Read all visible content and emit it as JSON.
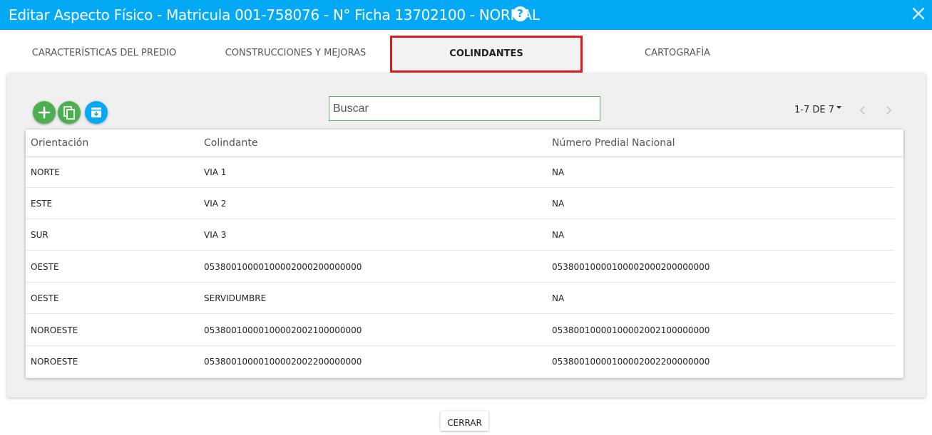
{
  "window": {
    "title": "Editar Aspecto Físico - Matricula 001-758076 - N° Ficha 13702100 - NORMAL"
  },
  "tabs": [
    {
      "label": "CARACTERÍSTICAS DEL PREDIO"
    },
    {
      "label": "CONSTRUCCIONES Y MEJORAS"
    },
    {
      "label": "COLINDANTES"
    },
    {
      "label": "CARTOGRAFÍA"
    }
  ],
  "search": {
    "placeholder": "Buscar"
  },
  "pager": {
    "label": "1-7 DE 7"
  },
  "table": {
    "headers": [
      "Orientación",
      "Colindante",
      "Número Predial Nacional"
    ],
    "rows": [
      [
        "NORTE",
        "VIA 1",
        "NA"
      ],
      [
        "ESTE",
        "VIA 2",
        "NA"
      ],
      [
        "SUR",
        "VIA 3",
        "NA"
      ],
      [
        "OESTE",
        "05380010000100002000200000000",
        "05380010000100002000200000000"
      ],
      [
        "OESTE",
        "SERVIDUMBRE",
        "NA"
      ],
      [
        "NOROESTE",
        "05380010000100002002100000000",
        "05380010000100002002100000000"
      ],
      [
        "NOROESTE",
        "05380010000100002002200000000",
        "05380010000100002002200000000"
      ]
    ]
  },
  "footer": {
    "close_label": "CERRAR"
  },
  "colors": {
    "header": "#03a9f4",
    "add": "#4caf50",
    "highlight": "#e01b1b"
  },
  "icons": [
    "help-icon",
    "close-icon",
    "add-icon",
    "copy-icon",
    "archive-icon",
    "chevron-left-icon",
    "chevron-right-icon",
    "caret-down-icon"
  ]
}
